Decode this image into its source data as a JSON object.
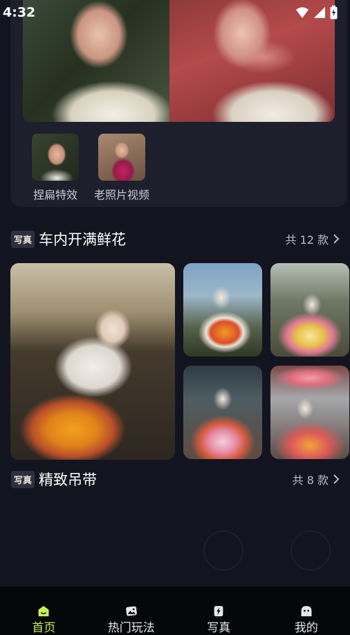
{
  "status_bar": {
    "time": "4:32"
  },
  "tools": [
    {
      "label": "捏扁特效"
    },
    {
      "label": "老照片视频"
    }
  ],
  "sections": [
    {
      "tag": "写真",
      "title": "车内开满鲜花",
      "count": "共 12 款"
    },
    {
      "tag": "写真",
      "title": "精致吊带",
      "count": "共 8 款"
    }
  ],
  "tabbar": {
    "items": [
      {
        "label": "首页",
        "icon": "home-icon",
        "active": true
      },
      {
        "label": "热门玩法",
        "icon": "image-icon",
        "active": false
      },
      {
        "label": "写真",
        "icon": "bolt-icon",
        "active": false
      },
      {
        "label": "我的",
        "icon": "profile-icon",
        "active": false
      }
    ]
  },
  "colors": {
    "accent": "#c8f05a",
    "background": "#121420",
    "card": "#1d1f2c"
  }
}
